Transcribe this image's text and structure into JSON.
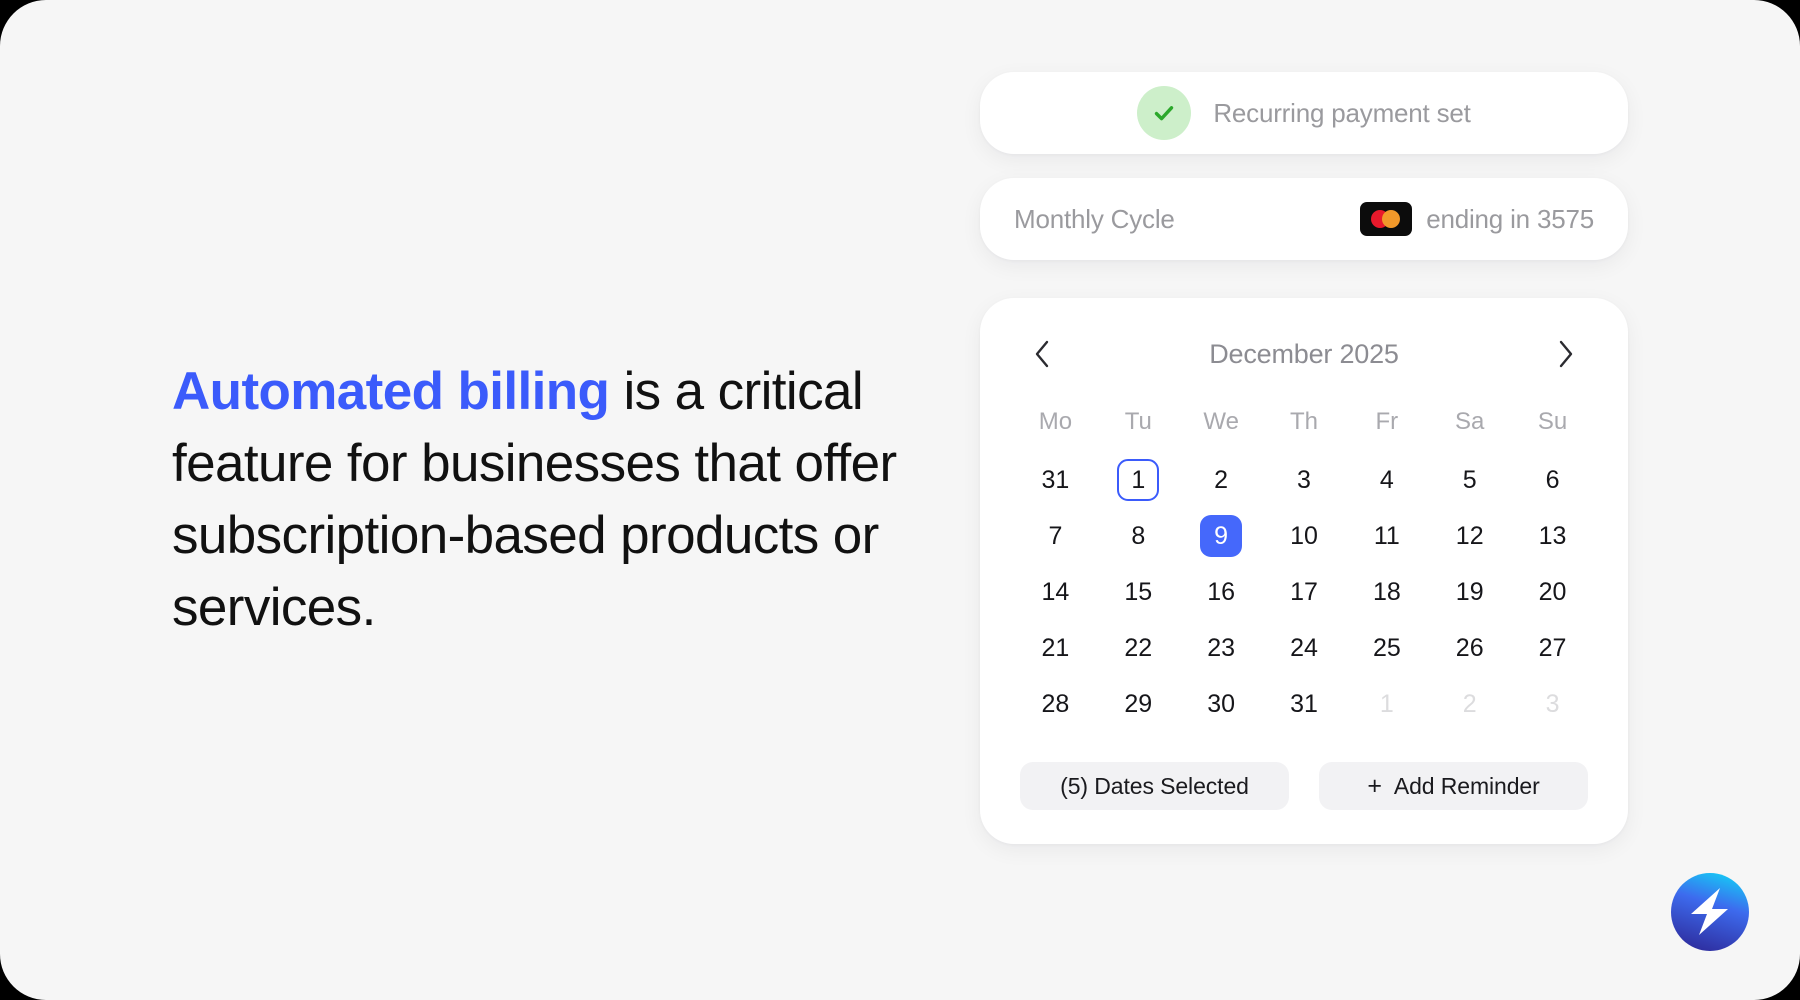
{
  "theme": {
    "background": "#F6F6F6",
    "accent_blue": "#3B5BFB",
    "selected_blue": "#4568FB",
    "muted_text": "#9A9A9E",
    "green_check": "#2BA82B",
    "green_circle": "#CDEFCA"
  },
  "headline": {
    "accent": "Automated billing",
    "rest": " is a critical feature for businesses that offer subscription-based products or services."
  },
  "status_card": {
    "icon": "check-circle-icon",
    "text": "Recurring payment set"
  },
  "billing_card": {
    "cycle_label": "Monthly Cycle",
    "card_brand_icon": "mastercard-icon",
    "card_text": "ending in 3575"
  },
  "calendar": {
    "prev_icon": "chevron-left-icon",
    "next_icon": "chevron-right-icon",
    "title": "December 2025",
    "weekdays": [
      "Mo",
      "Tu",
      "We",
      "Th",
      "Fr",
      "Sa",
      "Su"
    ],
    "days": [
      {
        "label": "31",
        "state": "normal"
      },
      {
        "label": "1",
        "state": "outlined"
      },
      {
        "label": "2",
        "state": "normal"
      },
      {
        "label": "3",
        "state": "normal"
      },
      {
        "label": "4",
        "state": "normal"
      },
      {
        "label": "5",
        "state": "normal"
      },
      {
        "label": "6",
        "state": "normal"
      },
      {
        "label": "7",
        "state": "normal"
      },
      {
        "label": "8",
        "state": "normal"
      },
      {
        "label": "9",
        "state": "selected"
      },
      {
        "label": "10",
        "state": "normal"
      },
      {
        "label": "11",
        "state": "normal"
      },
      {
        "label": "12",
        "state": "normal"
      },
      {
        "label": "13",
        "state": "normal"
      },
      {
        "label": "14",
        "state": "normal"
      },
      {
        "label": "15",
        "state": "normal"
      },
      {
        "label": "16",
        "state": "normal"
      },
      {
        "label": "17",
        "state": "normal"
      },
      {
        "label": "18",
        "state": "normal"
      },
      {
        "label": "19",
        "state": "normal"
      },
      {
        "label": "20",
        "state": "normal"
      },
      {
        "label": "21",
        "state": "normal"
      },
      {
        "label": "22",
        "state": "normal"
      },
      {
        "label": "23",
        "state": "normal"
      },
      {
        "label": "24",
        "state": "normal"
      },
      {
        "label": "25",
        "state": "normal"
      },
      {
        "label": "26",
        "state": "normal"
      },
      {
        "label": "27",
        "state": "normal"
      },
      {
        "label": "28",
        "state": "normal"
      },
      {
        "label": "29",
        "state": "normal"
      },
      {
        "label": "30",
        "state": "normal"
      },
      {
        "label": "31",
        "state": "normal"
      },
      {
        "label": "1",
        "state": "muted"
      },
      {
        "label": "2",
        "state": "muted"
      },
      {
        "label": "3",
        "state": "muted"
      }
    ],
    "actions": {
      "dates_selected": "(5) Dates Selected",
      "add_reminder": "Add Reminder",
      "add_reminder_plus": "+"
    }
  },
  "brand": {
    "logo_icon": "lightning-bolt-circle-logo"
  }
}
